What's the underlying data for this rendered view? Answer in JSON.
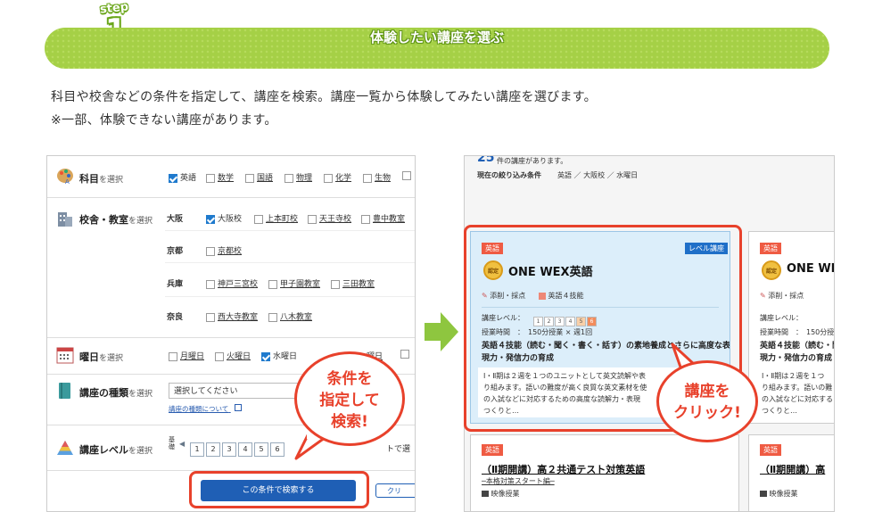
{
  "header": {
    "step_word": "step",
    "step_number": "1",
    "title": "体験したい講座を選ぶ",
    "description_1": "科目や校舎などの条件を指定して、講座を検索。講座一覧から体験してみたい講座を選びます。",
    "description_2": "※一部、体験できない講座があります。"
  },
  "search_panel": {
    "subject": {
      "label": "科目",
      "suffix": "を選択",
      "options": [
        {
          "label": "英語",
          "checked": true
        },
        {
          "label": "数学",
          "checked": false
        },
        {
          "label": "国語",
          "checked": false
        },
        {
          "label": "物理",
          "checked": false
        },
        {
          "label": "化学",
          "checked": false
        },
        {
          "label": "生物",
          "checked": false
        }
      ]
    },
    "school": {
      "label": "校舎・教室",
      "suffix": "を選択",
      "groups": [
        {
          "pref": "大阪",
          "options": [
            {
              "label": "大阪校",
              "checked": true
            },
            {
              "label": "上本町校",
              "checked": false
            },
            {
              "label": "天王寺校",
              "checked": false
            },
            {
              "label": "豊中教室",
              "checked": false
            }
          ]
        },
        {
          "pref": "京都",
          "options": [
            {
              "label": "京都校",
              "checked": false
            }
          ]
        },
        {
          "pref": "兵庫",
          "options": [
            {
              "label": "神戸三宮校",
              "checked": false
            },
            {
              "label": "甲子園教室",
              "checked": false
            },
            {
              "label": "三田教室",
              "checked": false
            }
          ]
        },
        {
          "pref": "奈良",
          "options": [
            {
              "label": "西大寺教室",
              "checked": false
            },
            {
              "label": "八木教室",
              "checked": false
            }
          ]
        }
      ]
    },
    "weekday": {
      "label": "曜日",
      "suffix": "を選択",
      "options": [
        {
          "label": "月曜日",
          "checked": false
        },
        {
          "label": "火曜日",
          "checked": false
        },
        {
          "label": "水曜日",
          "checked": true
        }
      ],
      "partial_option": "曜日"
    },
    "course_type": {
      "label": "講座の種類",
      "suffix": "を選択",
      "select_placeholder": "選択してください",
      "note_link": "講座の種類について"
    },
    "level": {
      "label": "講座レベル",
      "suffix": "を選択",
      "prefix": "基礎",
      "numbers": [
        "1",
        "2",
        "3",
        "4",
        "5",
        "6"
      ],
      "tail_text": "トで選"
    },
    "search_button": "この条件で検索する",
    "clear_button": "クリ",
    "callout": [
      "条件を",
      "指定して",
      "検索!"
    ]
  },
  "results_panel": {
    "count_number": "25",
    "count_text": "件の講座があります。",
    "filter_label": "現在の絞り込み条件",
    "filter_values": "英語 ／ 大阪校 ／ 水曜日",
    "card1": {
      "subject_tag": "英語",
      "level_tag": "レベル講座",
      "badge": "認定",
      "title": "ONE WEX英語",
      "feature_1": "添削・採点",
      "feature_2": "英語４技能",
      "level_label": "講座レベル：",
      "level_numbers": [
        "1",
        "2",
        "3",
        "4",
        "5",
        "6"
      ],
      "time_label": "授業時間",
      "time_value": "150分授業 × 週1回",
      "headline_1": "英語４技能（読む・聞く・書く・話す）の素地養成とさらに高度な表",
      "headline_2": "現力・発信力の育成",
      "body_1": "Ⅰ・Ⅱ期は２週を１つのユニットとして英文読解や表",
      "body_2": "り組みます。語いの難度が高く良質な英文素材を使",
      "body_3": "の入試などに対応するための高度な読解力・表現",
      "body_4": "つくりと…"
    },
    "card2": {
      "subject_tag": "英語",
      "badge": "認定",
      "title": "ONE WEX",
      "feature_1": "添削・採点",
      "level_label": "講座レベル：",
      "time_label": "授業時間",
      "time_value": "150分授",
      "headline_1": "英語４技能（読む・聞",
      "headline_2": "現力・発信力の育成",
      "body_1": "Ⅰ・Ⅱ期は２週を１つ",
      "body_2": "り組みます。語いの難",
      "body_3": "の入試などに対応する",
      "body_4": "つくりと…"
    },
    "card3": {
      "subject_tag": "英語",
      "title": "（Ⅱ期開講）高２共通テスト対策英語",
      "subtitle": "─本格対策スタート編─",
      "type": "映像授業"
    },
    "card4": {
      "subject_tag": "英語",
      "title": "（Ⅱ期開講）高",
      "type": "映像授業"
    },
    "callout": [
      "講座を",
      "クリック!"
    ]
  }
}
